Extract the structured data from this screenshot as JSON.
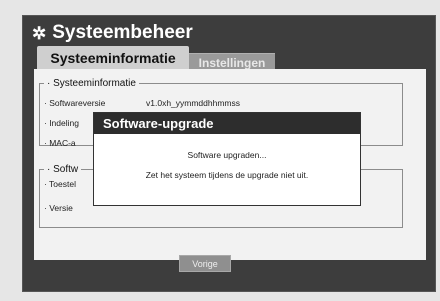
{
  "header": {
    "title": "Systeembeheer",
    "icon": "gear-icon"
  },
  "tabs": [
    {
      "label": "Systeeminformatie",
      "active": true
    },
    {
      "label": "Instellingen",
      "active": false
    }
  ],
  "system_info": {
    "legend": "· Systeeminformatie",
    "rows": [
      {
        "label": "· Softwareversie",
        "value": "v1.0xh_yymmddhhmmss"
      },
      {
        "label": "· Indeling",
        "value": ""
      },
      {
        "label": "· MAC-a",
        "value": ""
      }
    ]
  },
  "software_group": {
    "legend": "· Softw",
    "rows": [
      {
        "label": "· Toestel"
      },
      {
        "label": "· Versie"
      }
    ]
  },
  "dialog": {
    "title": "Software-upgrade",
    "line1": "Software upgraden...",
    "line2": "Zet het systeem tijdens de upgrade niet uit."
  },
  "footer": {
    "prev_label": "Vorige"
  },
  "colors": {
    "frame": "#3d3d3d",
    "content": "#f2f2f2",
    "dialog_title_bg": "#2d2d2d"
  }
}
